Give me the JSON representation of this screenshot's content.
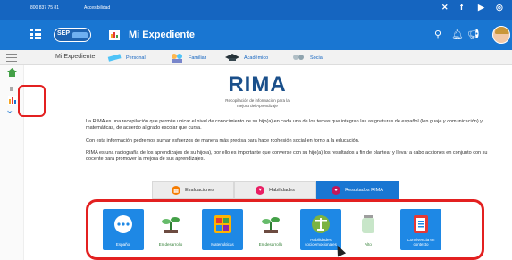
{
  "topbar": {
    "phone": "800 837 75 81",
    "accessibility": "Accesibilidad",
    "social_icons": [
      "twitter-icon",
      "facebook-icon",
      "youtube-icon",
      "instagram-icon"
    ]
  },
  "header": {
    "logo_text": "SEP",
    "app_title": "Mi Expediente",
    "icons": [
      "search-icon",
      "bell-icon",
      "megaphone-icon"
    ]
  },
  "subnav": {
    "breadcrumb": "Mi Expediente",
    "tabs": [
      {
        "label": "Personal",
        "icon": "ruler-icon"
      },
      {
        "label": "Familiar",
        "icon": "family-icon"
      },
      {
        "label": "Académico",
        "icon": "graduation-cap-icon"
      },
      {
        "label": "Social",
        "icon": "social-icon"
      }
    ]
  },
  "rima": {
    "title": "RIMA",
    "subtitle": "Recopilación de información para la mejora del Aprendizaje"
  },
  "paragraphs": {
    "p1_strong": "RIMA",
    "p1": "La RIMA es una recopilación que permite ubicar el nivel de conocimiento de su hijo(a) en cada una de los temas que integran las asignaturas de español (len guaje y comunicación) y matemáticas, de acuerdo al grado escolar que cursa.",
    "p2": "Con esta información pedremos sumar esfuerzos de manera más precisa para hace rcohesión social en torno a la educación.",
    "p3": "RIMA es una radiografía de los aprendizajes de su hijo(a), por ello es importante que converse con su hijo(a) los resultados a fin de plantear y llevar a cabo acciones en conjunto con su docente para promover la mejora de sus aprendizajes."
  },
  "rima_tabs": [
    {
      "label": "Evaluaciones",
      "color": "#f57c00",
      "active": false
    },
    {
      "label": "Habilidades",
      "color": "#e91e63",
      "active": false
    },
    {
      "label": "Resultados RIMA",
      "color": "#c2185b",
      "active": true
    }
  ],
  "cards": [
    {
      "label": "Español",
      "style": "blue",
      "icon": "chat-bubble-icon"
    },
    {
      "label": "En desarrollo",
      "style": "plain",
      "icon": "sprout-icon"
    },
    {
      "label": "Matemáticas",
      "style": "blue",
      "icon": "calculator-icon"
    },
    {
      "label": "En desarrollo",
      "style": "plain",
      "icon": "sprout-icon"
    },
    {
      "label": "Habilidades socioemocionales",
      "style": "blue",
      "icon": "balance-icon"
    },
    {
      "label": "Alto",
      "style": "plain",
      "icon": "jar-icon"
    },
    {
      "label": "Convivencia en contexto",
      "style": "blue",
      "icon": "clipboard-icon"
    }
  ],
  "colors": {
    "topbar": "#1565c0",
    "header": "#1976d2",
    "highlight": "#e32020",
    "rima_title": "#1a4f8a"
  }
}
